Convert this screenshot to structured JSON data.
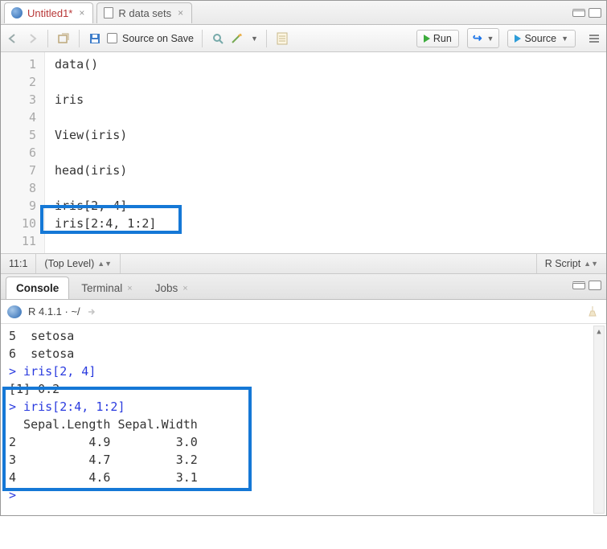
{
  "editor": {
    "tabs": [
      {
        "label": "Untitled1*",
        "icon": "rlogo",
        "unsaved": true
      },
      {
        "label": "R data sets",
        "icon": "doc",
        "unsaved": false
      }
    ],
    "toolbar": {
      "source_on_save": "Source on Save",
      "run": "Run",
      "source": "Source"
    },
    "lines": [
      "1",
      "2",
      "3",
      "4",
      "5",
      "6",
      "7",
      "8",
      "9",
      "10",
      "11"
    ],
    "code": "data()\n\niris\n\nView(iris)\n\nhead(iris)\n\niris[2, 4]\niris[2:4, 1:2]\n",
    "status_pos": "11:1",
    "status_scope": "(Top Level)",
    "status_type": "R Script"
  },
  "console": {
    "tabs": {
      "console": "Console",
      "terminal": "Terminal",
      "jobs": "Jobs"
    },
    "path_label": "R 4.1.1 · ~/",
    "pre_lines": [
      {
        "t": "5  setosa",
        "cls": ""
      },
      {
        "t": "6  setosa",
        "cls": ""
      },
      {
        "t": "> iris[2, 4]",
        "cls": "blue"
      },
      {
        "t": "[1] 0.2",
        "cls": ""
      },
      {
        "t": "> iris[2:4, 1:2]",
        "cls": "blue"
      },
      {
        "t": "  Sepal.Length Sepal.Width",
        "cls": ""
      },
      {
        "t": "2          4.9         3.0",
        "cls": ""
      },
      {
        "t": "3          4.7         3.2",
        "cls": ""
      },
      {
        "t": "4          4.6         3.1",
        "cls": ""
      },
      {
        "t": "> ",
        "cls": "blue"
      }
    ]
  },
  "chart_data": {
    "type": "table",
    "title": "iris[2:4, 1:2]",
    "columns": [
      "",
      "Sepal.Length",
      "Sepal.Width"
    ],
    "rows": [
      [
        "2",
        4.9,
        3.0
      ],
      [
        "3",
        4.7,
        3.2
      ],
      [
        "4",
        4.6,
        3.1
      ]
    ]
  }
}
